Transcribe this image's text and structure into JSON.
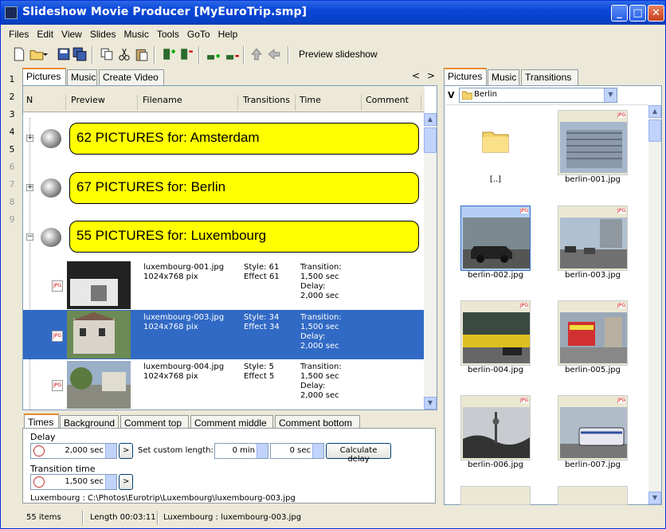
{
  "window": {
    "title": "Slideshow Movie Producer [MyEuroTrip.smp]"
  },
  "menu": [
    "Files",
    "Edit",
    "View",
    "Slides",
    "Music",
    "Tools",
    "GoTo",
    "Help"
  ],
  "toolbar": {
    "preview_label": "Preview slideshow"
  },
  "rownums": [
    "1",
    "2",
    "3",
    "4",
    "5",
    "6",
    "7",
    "8",
    "9"
  ],
  "left_tabs": [
    "Pictures",
    "Music",
    "Create Video"
  ],
  "nav_arrows": {
    "prev": "<",
    "next": ">"
  },
  "columns": [
    "N",
    "Preview",
    "Filename",
    "Transitions",
    "Time",
    "Comment"
  ],
  "groups": [
    {
      "label": "62 PICTURES for:  Amsterdam",
      "expander": "+"
    },
    {
      "label": "67 PICTURES for:  Berlin",
      "expander": "+"
    },
    {
      "label": "55 PICTURES for:  Luxembourg",
      "expander": "−"
    }
  ],
  "pictures": [
    {
      "filename": "luxembourg-001.jpg",
      "size": "1024x768 pix",
      "style": "Style: 61",
      "effect": "Effect 61",
      "time": "Transition:\n1,500 sec\nDelay:\n2,000 sec",
      "icon": "JPG"
    },
    {
      "filename": "luxembourg-003.jpg",
      "size": "1024x768 pix",
      "style": "Style: 34",
      "effect": "Effect 34",
      "time": "Transition:\n1,500 sec\nDelay:\n2,000 sec",
      "icon": "JPG"
    },
    {
      "filename": "luxembourg-004.jpg",
      "size": "1024x768 pix",
      "style": "Style: 5",
      "effect": "Effect 5",
      "time": "Transition:\n1,500 sec\nDelay:\n2,000 sec",
      "icon": "JPG"
    }
  ],
  "bottom_tabs": [
    "Times",
    "Background",
    "Comment top",
    "Comment middle",
    "Comment bottom"
  ],
  "times": {
    "delay_label": "Delay",
    "delay_value": "2,000 sec",
    "custom_length_label": "Set custom length:",
    "min_value": "0 min",
    "sec_value": "0 sec",
    "calc_button": "Calculate delay",
    "transition_label": "Transition time",
    "transition_value": "1,500 sec",
    "go_button": ">",
    "path": "Luxembourg : C:\\Photos\\Eurotrip\\Luxembourg\\luxembourg-003.jpg"
  },
  "right_tabs": [
    "Pictures",
    "Music",
    "Transitions"
  ],
  "folder_select": {
    "drive": "V",
    "folder": "Berlin"
  },
  "gallery": [
    {
      "label": "[..]",
      "type": "folder"
    },
    {
      "label": "berlin-001.jpg",
      "type": "image",
      "icon": "JPG"
    },
    {
      "label": "berlin-002.jpg",
      "type": "image",
      "icon": "JPG",
      "selected": true
    },
    {
      "label": "berlin-003.jpg",
      "type": "image",
      "icon": "JPG"
    },
    {
      "label": "berlin-004.jpg",
      "type": "image",
      "icon": "JPG"
    },
    {
      "label": "berlin-005.jpg",
      "type": "image",
      "icon": "JPG"
    },
    {
      "label": "berlin-006.jpg",
      "type": "image",
      "icon": "JPG"
    },
    {
      "label": "berlin-007.jpg",
      "type": "image",
      "icon": "JPG"
    }
  ],
  "status": {
    "items": "55 items",
    "length": "Length 00:03:11",
    "current": "Luxembourg : luxembourg-003.jpg"
  },
  "colors": {
    "accent": "#316ac5",
    "group_bg": "#ffff00",
    "title_blue": "#0a46d7"
  }
}
